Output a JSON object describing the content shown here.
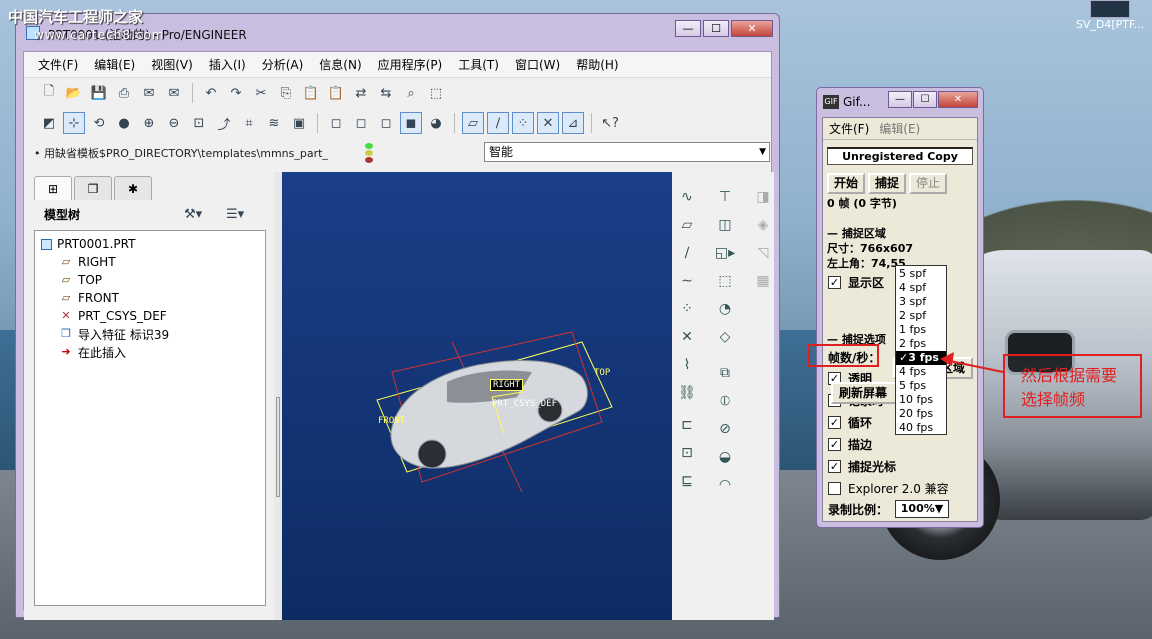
{
  "desktop": {
    "watermark": "中国汽车工程师之家",
    "watermark_url": "www.cartech8.com",
    "icon_label": "SV_D4[PTF..."
  },
  "proe": {
    "title": "PRT0001 (活动的) - Pro/ENGINEER",
    "menu": [
      "文件(F)",
      "编辑(E)",
      "视图(V)",
      "插入(I)",
      "分析(A)",
      "信息(N)",
      "应用程序(P)",
      "工具(T)",
      "窗口(W)",
      "帮助(H)"
    ],
    "template_path": "• 用缺省模板$PRO_DIRECTORY\\templates\\mmns_part_",
    "filter_value": "智能",
    "model_tree_label": "模型树",
    "tree": [
      {
        "icon": "part-icon",
        "label": "PRT0001.PRT"
      },
      {
        "icon": "datum-plane-icon",
        "label": "RIGHT"
      },
      {
        "icon": "datum-plane-icon",
        "label": "TOP"
      },
      {
        "icon": "datum-plane-icon",
        "label": "FRONT"
      },
      {
        "icon": "csys-icon",
        "label": "PRT_CSYS_DEF"
      },
      {
        "icon": "import-feature-icon",
        "label": "导入特征 标识39"
      },
      {
        "icon": "insert-here-icon",
        "label": "在此插入"
      }
    ],
    "graphics_labels": {
      "front": "FRONT",
      "top": "TOP",
      "right": "RIGHT",
      "csys": "PRT_CSYS_DEF"
    }
  },
  "gif": {
    "title": "Gif...",
    "menu": [
      "文件(F)",
      "编辑(E)"
    ],
    "banner": "Unregistered Copy",
    "buttons": {
      "start": "开始",
      "capture": "捕捉",
      "stop": "停止"
    },
    "frames_info": "0 帧 (0 字节)",
    "capture_area_header": "捕捉区域",
    "size": "尺寸：766x607",
    "top_left": "左上角：74,55",
    "show_area": "显示区",
    "area_btn_tail": "区域",
    "refresh_btn": "刷新屏幕",
    "capture_options_header": "捕捉选项",
    "fps_label": "帧数/秒：",
    "fps_options": [
      "5 spf",
      "4 spf",
      "3 spf",
      "2 spf",
      "1 fps",
      "2 fps",
      "✓3 fps",
      "4 fps",
      "5 fps",
      "10 fps",
      "20 fps",
      "40 fps"
    ],
    "fps_selected_index": 6,
    "checks": [
      {
        "label": "透明",
        "checked": true
      },
      {
        "label": "记录时",
        "checked": true
      },
      {
        "label": "循环",
        "checked": true
      },
      {
        "label": "描边",
        "checked": true
      },
      {
        "label": "捕捉光标",
        "checked": true
      },
      {
        "label": "Explorer 2.0 兼容",
        "checked": false
      }
    ],
    "ratio_label": "录制比例：",
    "ratio_value": "100%▼"
  },
  "annotation": {
    "line1": "然后根据需要",
    "line2": "选择帧频",
    "color": "#e02020"
  }
}
